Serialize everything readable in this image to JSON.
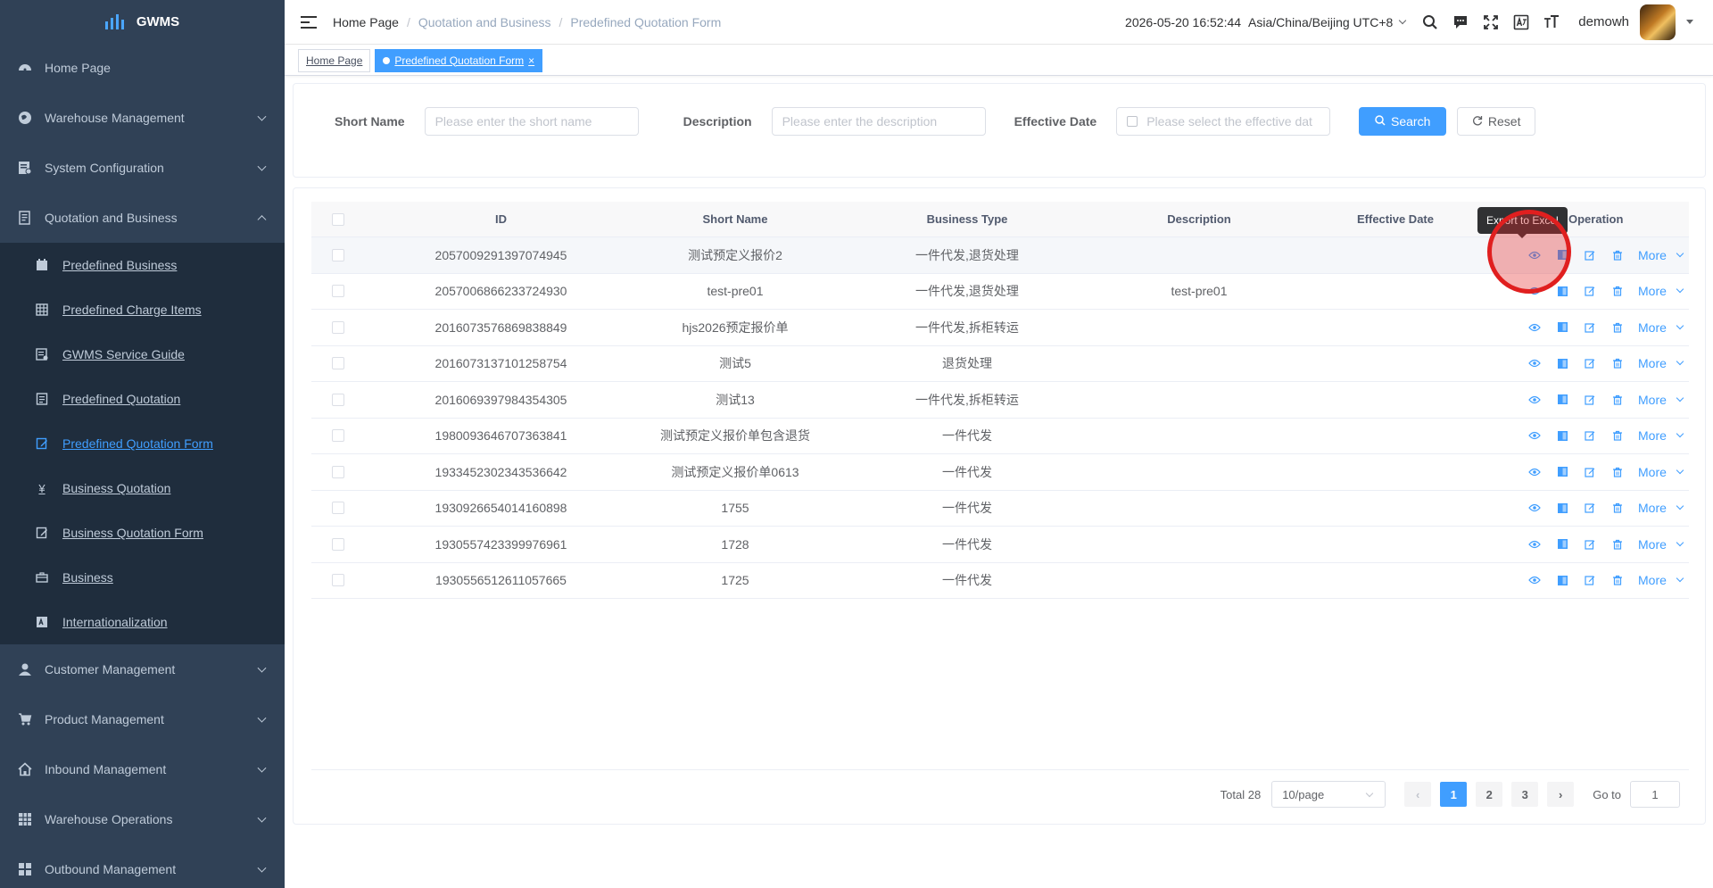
{
  "sidebar": {
    "logo_text": "GWMS",
    "items": [
      {
        "label": "Home Page"
      },
      {
        "label": "Warehouse Management"
      },
      {
        "label": "System Configuration"
      },
      {
        "label": "Quotation and Business"
      },
      {
        "label": "Customer Management"
      },
      {
        "label": "Product Management"
      },
      {
        "label": "Inbound Management"
      },
      {
        "label": "Warehouse Operations"
      },
      {
        "label": "Outbound Management"
      }
    ],
    "submenu": [
      {
        "label": "Predefined Business"
      },
      {
        "label": "Predefined Charge Items"
      },
      {
        "label": "GWMS Service Guide"
      },
      {
        "label": "Predefined Quotation"
      },
      {
        "label": "Predefined Quotation Form"
      },
      {
        "label": "Business Quotation"
      },
      {
        "label": "Business Quotation Form"
      },
      {
        "label": "Business"
      },
      {
        "label": "Internationalization"
      }
    ]
  },
  "header": {
    "breadcrumb": [
      "Home Page",
      "Quotation and Business",
      "Predefined Quotation Form"
    ],
    "datetime": "2026-05-20 16:52:44",
    "timezone": "Asia/China/Beijing UTC+8",
    "username": "demowh"
  },
  "tags": {
    "home": "Home Page",
    "active": "Predefined Quotation Form"
  },
  "search": {
    "short_name_label": "Short Name",
    "short_name_placeholder": "Please enter the short name",
    "description_label": "Description",
    "description_placeholder": "Please enter the description",
    "effective_date_label": "Effective Date",
    "effective_date_placeholder": "Please select the effective dat",
    "search_button": "Search",
    "reset_button": "Reset"
  },
  "table": {
    "columns": {
      "id": "ID",
      "short_name": "Short Name",
      "business_type": "Business Type",
      "description": "Description",
      "effective_date": "Effective Date",
      "operation": "Operation"
    },
    "more_label": "More",
    "rows": [
      {
        "id": "2057009291397074945",
        "short_name": "测试预定义报价2",
        "business_type": "一件代发,退货处理",
        "description": "",
        "effective_date": ""
      },
      {
        "id": "2057006866233724930",
        "short_name": "test-pre01",
        "business_type": "一件代发,退货处理",
        "description": "test-pre01",
        "effective_date": ""
      },
      {
        "id": "2016073576869838849",
        "short_name": "hjs2026预定报价单",
        "business_type": "一件代发,拆柜转运",
        "description": "",
        "effective_date": ""
      },
      {
        "id": "2016073137101258754",
        "short_name": "测试5",
        "business_type": "退货处理",
        "description": "",
        "effective_date": ""
      },
      {
        "id": "2016069397984354305",
        "short_name": "测试13",
        "business_type": "一件代发,拆柜转运",
        "description": "",
        "effective_date": ""
      },
      {
        "id": "1980093646707363841",
        "short_name": "测试预定义报价单包含退货",
        "business_type": "一件代发",
        "description": "",
        "effective_date": ""
      },
      {
        "id": "1933452302343536642",
        "short_name": "测试预定义报价单0613",
        "business_type": "一件代发",
        "description": "",
        "effective_date": ""
      },
      {
        "id": "1930926654014160898",
        "short_name": "1755",
        "business_type": "一件代发",
        "description": "",
        "effective_date": ""
      },
      {
        "id": "1930557423399976961",
        "short_name": "1728",
        "business_type": "一件代发",
        "description": "",
        "effective_date": ""
      },
      {
        "id": "1930556512611057665",
        "short_name": "1725",
        "business_type": "一件代发",
        "description": "",
        "effective_date": ""
      }
    ]
  },
  "tooltip": {
    "text": "Export to Excel"
  },
  "pagination": {
    "total": "Total 28",
    "page_size": "10/page",
    "pages": [
      "1",
      "2",
      "3"
    ],
    "prev": "‹",
    "next": "›",
    "goto_label": "Go to",
    "goto_value": "1"
  }
}
